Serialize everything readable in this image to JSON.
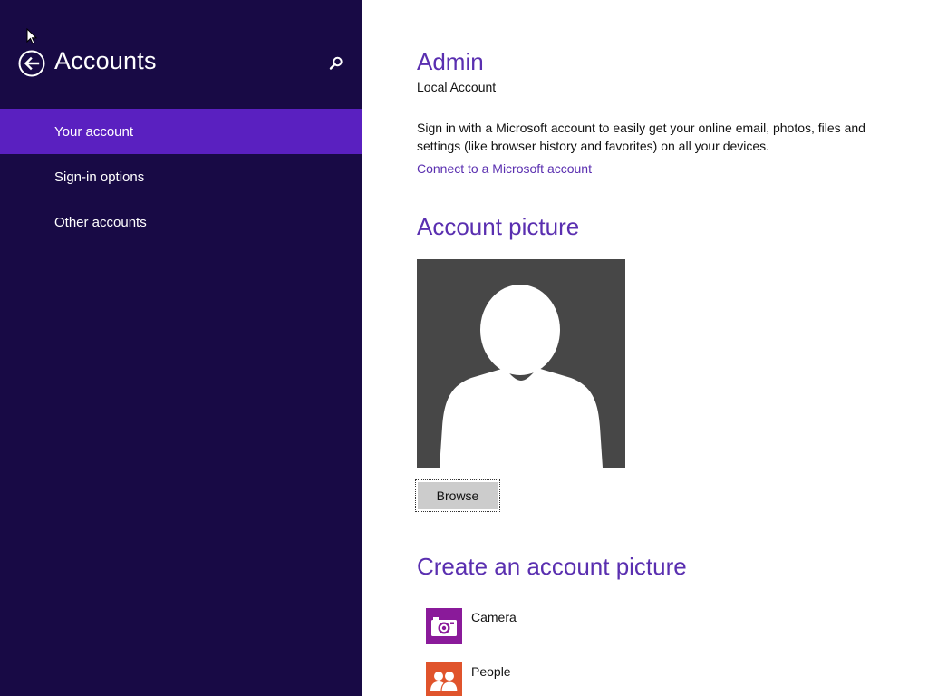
{
  "sidebar": {
    "title": "Accounts",
    "back_icon": "back-arrow-icon",
    "search_icon": "search-icon",
    "items": [
      {
        "label": "Your account",
        "selected": true
      },
      {
        "label": "Sign-in options",
        "selected": false
      },
      {
        "label": "Other accounts",
        "selected": false
      }
    ],
    "background_color": "#180a45",
    "selected_color": "#5a20c0"
  },
  "main": {
    "user_name": "Admin",
    "account_type": "Local Account",
    "description": "Sign in with a Microsoft account to easily get your online email, photos, files and settings (like browser history and favorites) on all your devices.",
    "connect_link": "Connect to a Microsoft account",
    "account_picture_heading": "Account picture",
    "avatar_icon": "default-user-silhouette-icon",
    "browse_label": "Browse",
    "create_heading": "Create an account picture",
    "apps": [
      {
        "label": "Camera",
        "icon": "camera-icon",
        "color": "#8a1a9a"
      },
      {
        "label": "People",
        "icon": "people-icon",
        "color": "#e0542c"
      }
    ],
    "accent_color": "#5a2fb0"
  }
}
